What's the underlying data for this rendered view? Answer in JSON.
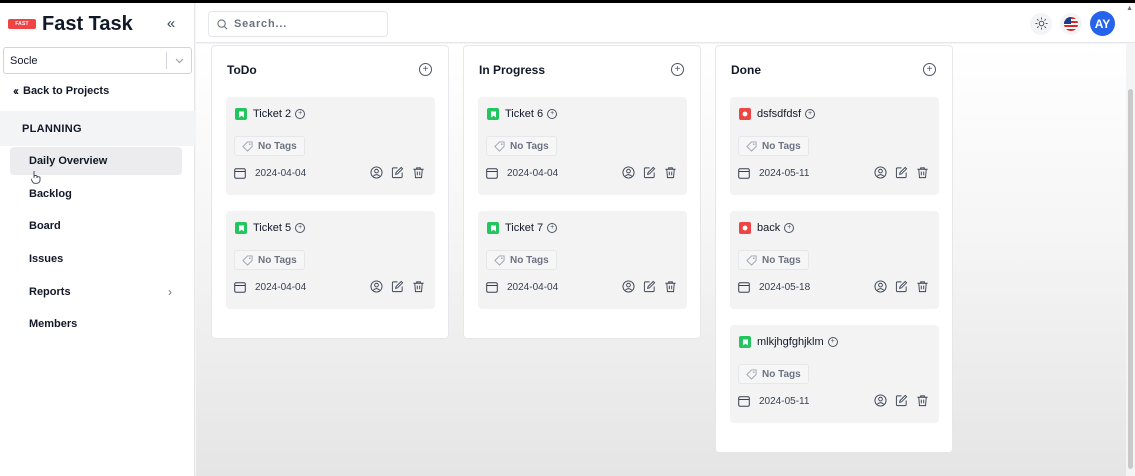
{
  "brand": {
    "logo_text": "FAST",
    "title": "Fast Task",
    "collapse_icon": "chevron-double-left-icon"
  },
  "sidebar": {
    "project": "Socle",
    "back_label": "Back to Projects",
    "section": "PLANNING",
    "items": [
      {
        "label": "Daily Overview",
        "active": true
      },
      {
        "label": "Backlog"
      },
      {
        "label": "Board"
      },
      {
        "label": "Issues"
      },
      {
        "label": "Reports",
        "has_arrow": true
      },
      {
        "label": "Members"
      }
    ]
  },
  "topbar": {
    "search_placeholder": "Search...",
    "avatar_initials": "AY"
  },
  "colors": {
    "story": "#22c55e",
    "bug": "#ef4444",
    "avatar": "#2563eb"
  },
  "board": {
    "columns": [
      {
        "title": "ToDo",
        "cards": [
          {
            "title": "Ticket 2",
            "type": "story",
            "tag": "No Tags",
            "date": "2024-04-04"
          },
          {
            "title": "Ticket 5",
            "type": "story",
            "tag": "No Tags",
            "date": "2024-04-04"
          }
        ]
      },
      {
        "title": "In Progress",
        "cards": [
          {
            "title": "Ticket 6",
            "type": "story",
            "tag": "No Tags",
            "date": "2024-04-04"
          },
          {
            "title": "Ticket 7",
            "type": "story",
            "tag": "No Tags",
            "date": "2024-04-04"
          }
        ]
      },
      {
        "title": "Done",
        "cards": [
          {
            "title": "dsfsdfdsf",
            "type": "bug",
            "tag": "No Tags",
            "date": "2024-05-11"
          },
          {
            "title": "back",
            "type": "bug",
            "tag": "No Tags",
            "date": "2024-05-18"
          },
          {
            "title": "mlkjhgfghjklm",
            "type": "story",
            "tag": "No Tags",
            "date": "2024-05-11"
          }
        ]
      }
    ]
  }
}
